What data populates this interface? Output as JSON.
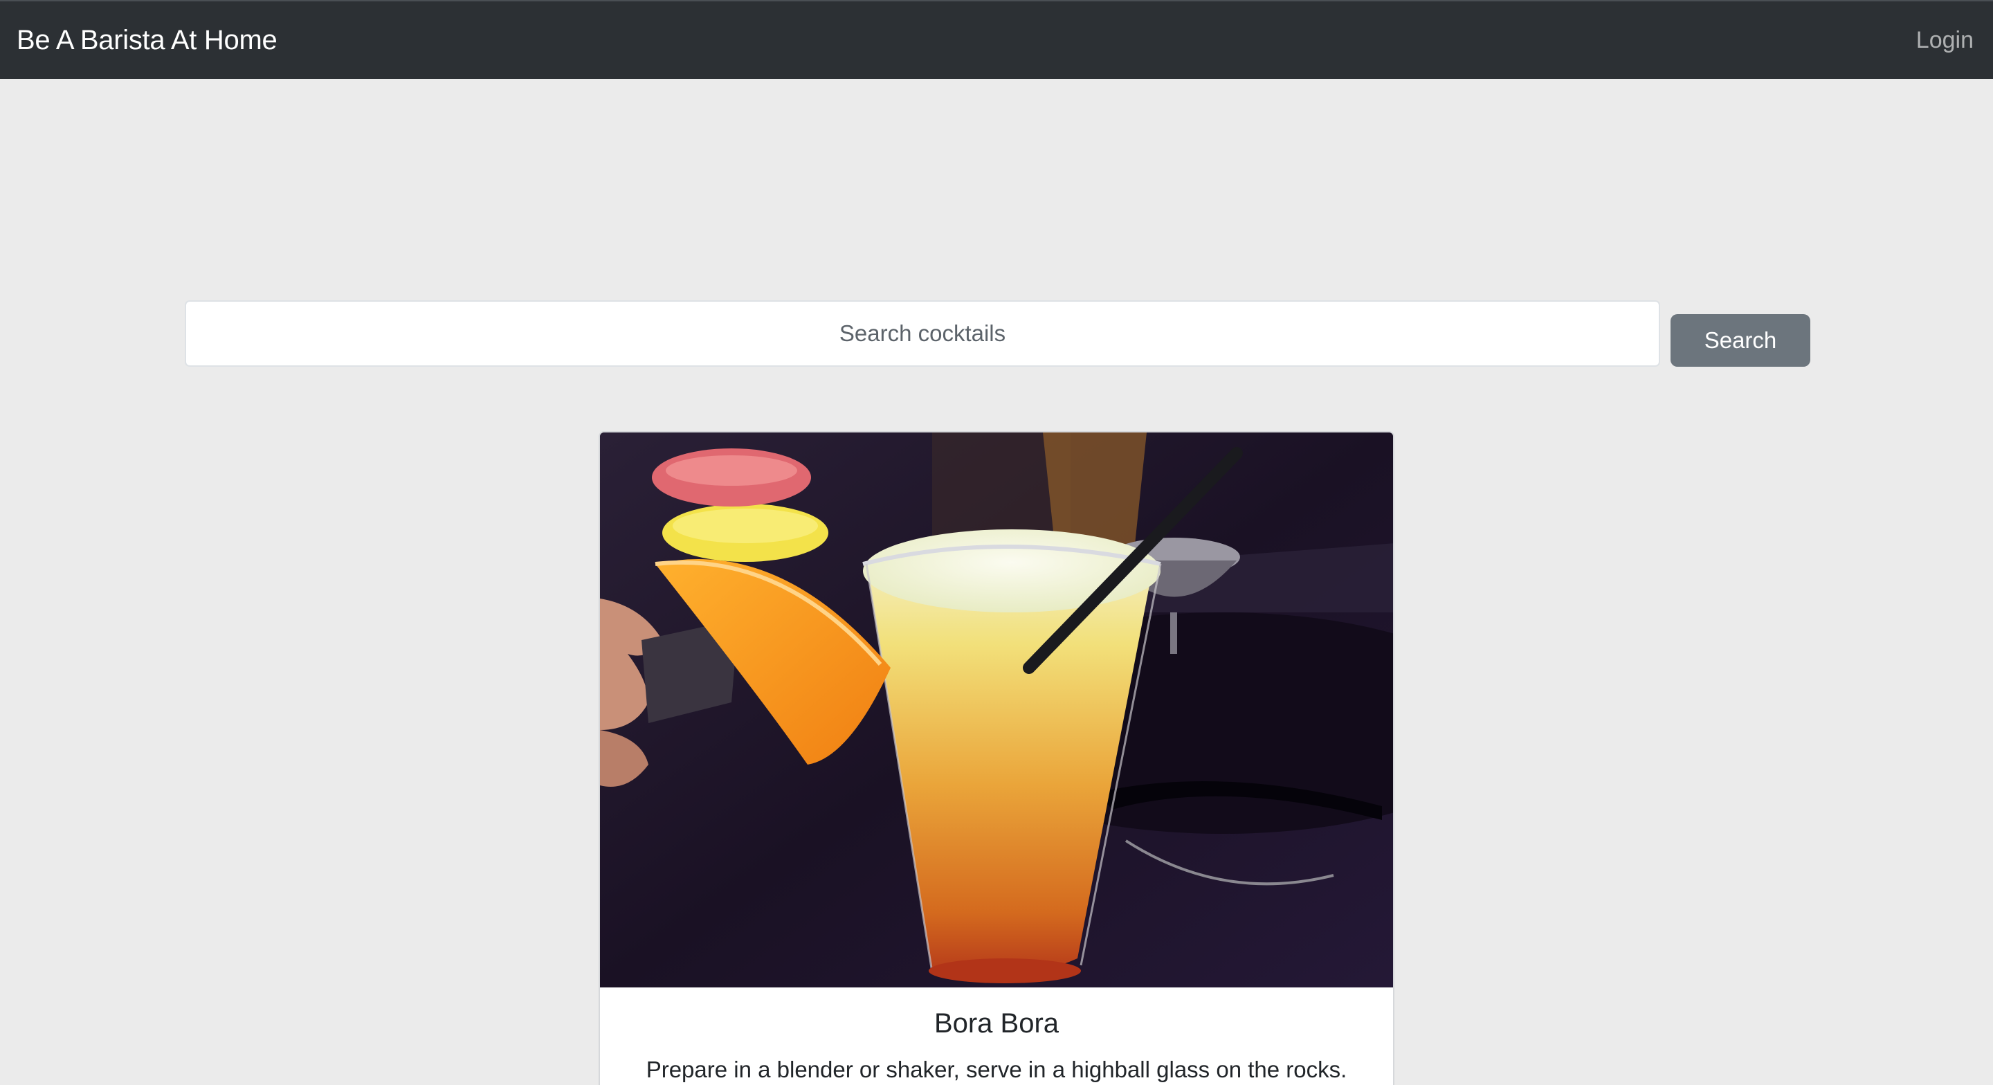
{
  "navbar": {
    "brand": "Be A Barista At Home",
    "login_label": "Login"
  },
  "search": {
    "placeholder": "Search cocktails",
    "value": "",
    "button_label": "Search"
  },
  "card": {
    "image_subject": "cocktail-photo",
    "title": "Bora Bora",
    "text": "Prepare in a blender or shaker, serve in a highball glass on the rocks."
  },
  "colors": {
    "navbar_bg": "#2c3034",
    "page_bg": "#ebebeb",
    "button_bg": "#6c757d"
  }
}
